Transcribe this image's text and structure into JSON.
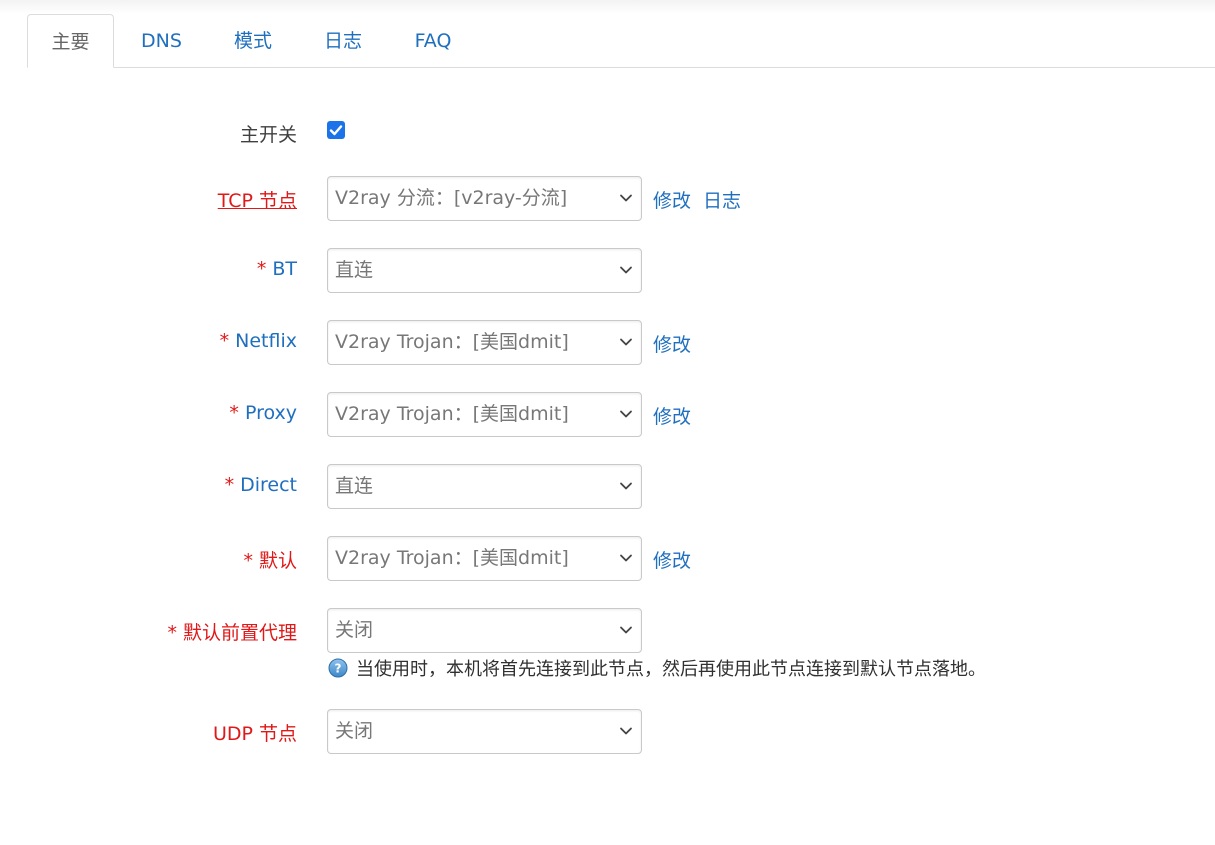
{
  "tabs": [
    {
      "label": "主要",
      "active": true
    },
    {
      "label": "DNS"
    },
    {
      "label": "模式"
    },
    {
      "label": "日志"
    },
    {
      "label": "FAQ"
    }
  ],
  "form": {
    "main_switch": {
      "label": "主开关",
      "checked": true
    },
    "tcp_node": {
      "label": "TCP 节点",
      "value": "V2ray 分流：[v2ray-分流]",
      "edit": "修改",
      "log": "日志"
    },
    "bt": {
      "star": "* ",
      "label": "BT",
      "value": "直连"
    },
    "netflix": {
      "star": "* ",
      "label": "Netflix",
      "value": "V2ray Trojan：[美国dmit]",
      "edit": "修改"
    },
    "proxy": {
      "star": "* ",
      "label": "Proxy",
      "value": "V2ray Trojan：[美国dmit]",
      "edit": "修改"
    },
    "direct": {
      "star": "* ",
      "label": "Direct",
      "value": "直连"
    },
    "default": {
      "star": "* ",
      "label": "默认",
      "value": "V2ray Trojan：[美国dmit]",
      "edit": "修改"
    },
    "default_pre_proxy": {
      "star": "* ",
      "label": "默认前置代理",
      "value": "关闭",
      "hint": "当使用时，本机将首先连接到此节点，然后再使用此节点连接到默认节点落地。"
    },
    "udp_node": {
      "label": "UDP 节点",
      "value": "关闭"
    }
  },
  "colors": {
    "link": "#1f6fbf",
    "required": "#e01818",
    "checkbox": "#1a73e8"
  },
  "icons": {
    "select_arrow": "chevron-down-icon",
    "hint": "question-icon",
    "checkbox": "checkmark-icon"
  }
}
